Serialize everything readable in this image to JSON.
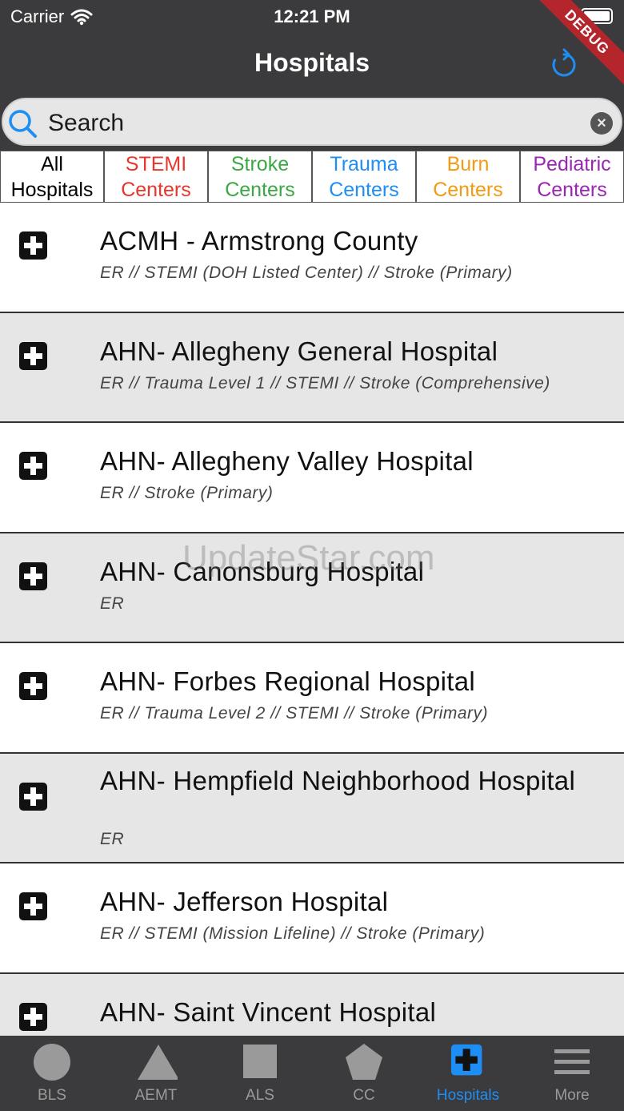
{
  "status_bar": {
    "carrier": "Carrier",
    "time": "12:21 PM"
  },
  "debug_banner": "DEBUG",
  "nav": {
    "title": "Hospitals",
    "refresh_icon": "refresh-icon"
  },
  "search": {
    "placeholder": "Search",
    "value": ""
  },
  "filters": [
    {
      "line1": "All",
      "line2": "Hospitals",
      "color": "#000000"
    },
    {
      "line1": "STEMI",
      "line2": "Centers",
      "color": "#e8362d"
    },
    {
      "line1": "Stroke",
      "line2": "Centers",
      "color": "#3aa845"
    },
    {
      "line1": "Trauma",
      "line2": "Centers",
      "color": "#1e8ef5"
    },
    {
      "line1": "Burn",
      "line2": "Centers",
      "color": "#f39a12"
    },
    {
      "line1": "Pediatric",
      "line2": "Centers",
      "color": "#9b25b5"
    }
  ],
  "hospitals": [
    {
      "name": "ACMH - Armstrong County",
      "details": "ER // STEMI (DOH Listed Center) // Stroke (Primary)"
    },
    {
      "name": "AHN- Allegheny General Hospital",
      "details": "ER // Trauma Level 1 // STEMI // Stroke (Comprehensive)"
    },
    {
      "name": "AHN- Allegheny Valley Hospital",
      "details": "ER // Stroke (Primary)"
    },
    {
      "name": "AHN- Canonsburg Hospital",
      "details": "ER"
    },
    {
      "name": "AHN- Forbes Regional Hospital",
      "details": "ER // Trauma Level 2 // STEMI // Stroke (Primary)"
    },
    {
      "name": "AHN- Hempfield Neighborhood Hospital",
      "details": "ER"
    },
    {
      "name": "AHN- Jefferson Hospital",
      "details": "ER // STEMI (Mission Lifeline) // Stroke (Primary)"
    },
    {
      "name": "AHN- Saint Vincent Hospital",
      "details": ""
    }
  ],
  "watermark": "UpdateStar.com",
  "tabs": [
    {
      "label": "BLS",
      "icon": "circle-icon"
    },
    {
      "label": "AEMT",
      "icon": "triangle-icon"
    },
    {
      "label": "ALS",
      "icon": "square-icon"
    },
    {
      "label": "CC",
      "icon": "pentagon-icon"
    },
    {
      "label": "Hospitals",
      "icon": "hospital-cross-icon",
      "active": true
    },
    {
      "label": "More",
      "icon": "menu-icon"
    }
  ],
  "colors": {
    "bar": "#3b3b3d",
    "accent": "#1e8ef5",
    "row_alt": "#e6e6e6"
  }
}
